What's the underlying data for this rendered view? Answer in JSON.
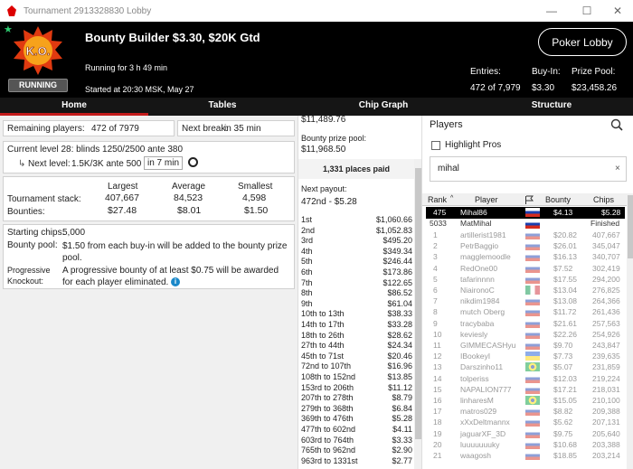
{
  "window": {
    "title": "Tournament 2913328830 Lobby",
    "minimize": "—",
    "maximize": "☐",
    "close": "✕"
  },
  "header": {
    "badge_text": "K.O.",
    "status": "RUNNING",
    "tournament_name": "Bounty Builder $3.30, $20K Gtd",
    "running_for": "Running for 3 h 49 min",
    "started_at": "Started at 20:30 MSK, May 27",
    "lobby_button": "Poker Lobby",
    "entries_label": "Entries:",
    "entries_value": "472 of 7,979",
    "buyin_label": "Buy-In:",
    "buyin_value": "$3.30",
    "prizepool_label": "Prize Pool:",
    "prizepool_value": "$23,458.26"
  },
  "tabs": [
    "Home",
    "Tables",
    "Chip Graph",
    "Structure"
  ],
  "home": {
    "remaining_label": "Remaining players:",
    "remaining_value": "472 of 7979",
    "nextbreak_label": "Next break:",
    "nextbreak_value": "in 35 min",
    "current_level": "Current level 28:  blinds 1250/2500 ante 380",
    "next_level_label": "Next level:",
    "next_level_value": "1.5K/3K ante 500",
    "next_level_time": "in 7 min",
    "headers": [
      "Largest",
      "Average",
      "Smallest"
    ],
    "stack_label": "Tournament stack:",
    "stack_values": [
      "407,667",
      "84,523",
      "4,598"
    ],
    "bounty_label": "Bounties:",
    "bounty_values": [
      "$27.48",
      "$8.01",
      "$1.50"
    ],
    "starting_label": "Starting chips:",
    "starting_value": "5,000",
    "pool_label": "Bounty pool:",
    "pool_value": "$1.50 from each buy-in will be added to the bounty prize pool.",
    "pko_label": "Progressive Knockout:",
    "pko_value": "A progressive bounty of at least $0.75 will be awarded for each player eliminated."
  },
  "payouts": {
    "top_cut": "$11,489.76",
    "bounty_pool_label": "Bounty prize pool:",
    "bounty_pool_value": "$11,968.50",
    "places_paid": "1,331 places paid",
    "next_payout_label": "Next payout:",
    "next_payout_value": "472nd - $5.28",
    "rows": [
      [
        "1st",
        "$1,060.66"
      ],
      [
        "2nd",
        "$1,052.83"
      ],
      [
        "3rd",
        "$495.20"
      ],
      [
        "4th",
        "$349.34"
      ],
      [
        "5th",
        "$246.44"
      ],
      [
        "6th",
        "$173.86"
      ],
      [
        "7th",
        "$122.65"
      ],
      [
        "8th",
        "$86.52"
      ],
      [
        "9th",
        "$61.04"
      ],
      [
        "10th to 13th",
        "$38.33"
      ],
      [
        "14th to 17th",
        "$33.28"
      ],
      [
        "18th to 26th",
        "$28.62"
      ],
      [
        "27th to 44th",
        "$24.34"
      ],
      [
        "45th to 71st",
        "$20.46"
      ],
      [
        "72nd to 107th",
        "$16.96"
      ],
      [
        "108th to 152nd",
        "$13.85"
      ],
      [
        "153rd to 206th",
        "$11.12"
      ],
      [
        "207th to 278th",
        "$8.79"
      ],
      [
        "279th to 368th",
        "$6.84"
      ],
      [
        "369th to 476th",
        "$5.28"
      ],
      [
        "477th to 602nd",
        "$4.11"
      ],
      [
        "603rd to 764th",
        "$3.33"
      ],
      [
        "765th to 962nd",
        "$2.90"
      ],
      [
        "963rd to 1331st",
        "$2.77"
      ]
    ]
  },
  "players": {
    "title": "Players",
    "highlight_label": "Highlight Pros",
    "search_value": "mihal",
    "search_clear": "×",
    "columns": [
      "Rank",
      "Player",
      "Bounty",
      "Chips"
    ],
    "selected": {
      "rank": "475",
      "name": "Mihal86",
      "bounty": "$4.13",
      "chips": "$5.28",
      "flag": "ru"
    },
    "finished": {
      "rank": "5033",
      "name": "MatMihal",
      "chips": "Finished",
      "flag": "ru"
    },
    "rows": [
      [
        "1",
        "artillerist1981",
        "$20.82",
        "407,667",
        "ru"
      ],
      [
        "2",
        "PetrBaggio",
        "$26.01",
        "345,047",
        "ru"
      ],
      [
        "3",
        "magglemoodle",
        "$16.13",
        "340,707",
        "ru"
      ],
      [
        "4",
        "RedOne00",
        "$7.52",
        "302,419",
        "ru"
      ],
      [
        "5",
        "tafarinnnn",
        "$17.55",
        "294,200",
        "ru"
      ],
      [
        "6",
        "NiaironoC",
        "$13.04",
        "276,825",
        "it"
      ],
      [
        "7",
        "nikdim1984",
        "$13.08",
        "264,366",
        "ru"
      ],
      [
        "8",
        "mutch Oberg",
        "$11.72",
        "261,436",
        "ru"
      ],
      [
        "9",
        "tracybaba",
        "$21.61",
        "257,563",
        "ru"
      ],
      [
        "10",
        "keviesly",
        "$22.26",
        "254,926",
        "ru"
      ],
      [
        "11",
        "GIMMECASHyu",
        "$9.70",
        "243,847",
        "ru"
      ],
      [
        "12",
        "IBookeyI",
        "$7.73",
        "239,635",
        "ua"
      ],
      [
        "13",
        "Darszinho11",
        "$5.07",
        "231,859",
        "br"
      ],
      [
        "14",
        "tolperiss",
        "$12.03",
        "219,224",
        "ru"
      ],
      [
        "15",
        "NAPALION777",
        "$17.21",
        "218,031",
        "ru"
      ],
      [
        "16",
        "linharesM",
        "$15.05",
        "210,100",
        "br"
      ],
      [
        "17",
        "matros029",
        "$8.82",
        "209,388",
        "ru"
      ],
      [
        "18",
        "xXxDeltmannx",
        "$5.62",
        "207,131",
        "ru"
      ],
      [
        "19",
        "jaguarXF_3D",
        "$9.75",
        "205,640",
        "ru"
      ],
      [
        "20",
        "luuuuuuuky",
        "$10.68",
        "203,388",
        "ru"
      ],
      [
        "21",
        "waagosh",
        "$18.85",
        "203,214",
        "ru"
      ]
    ]
  },
  "colors": {
    "accent": "#c31c1c",
    "header_bg": "#000000",
    "selected_row": "#000000",
    "ru_white": "#ffffff",
    "ru_blue": "#1c3fb0",
    "ru_red": "#d52b1e"
  }
}
